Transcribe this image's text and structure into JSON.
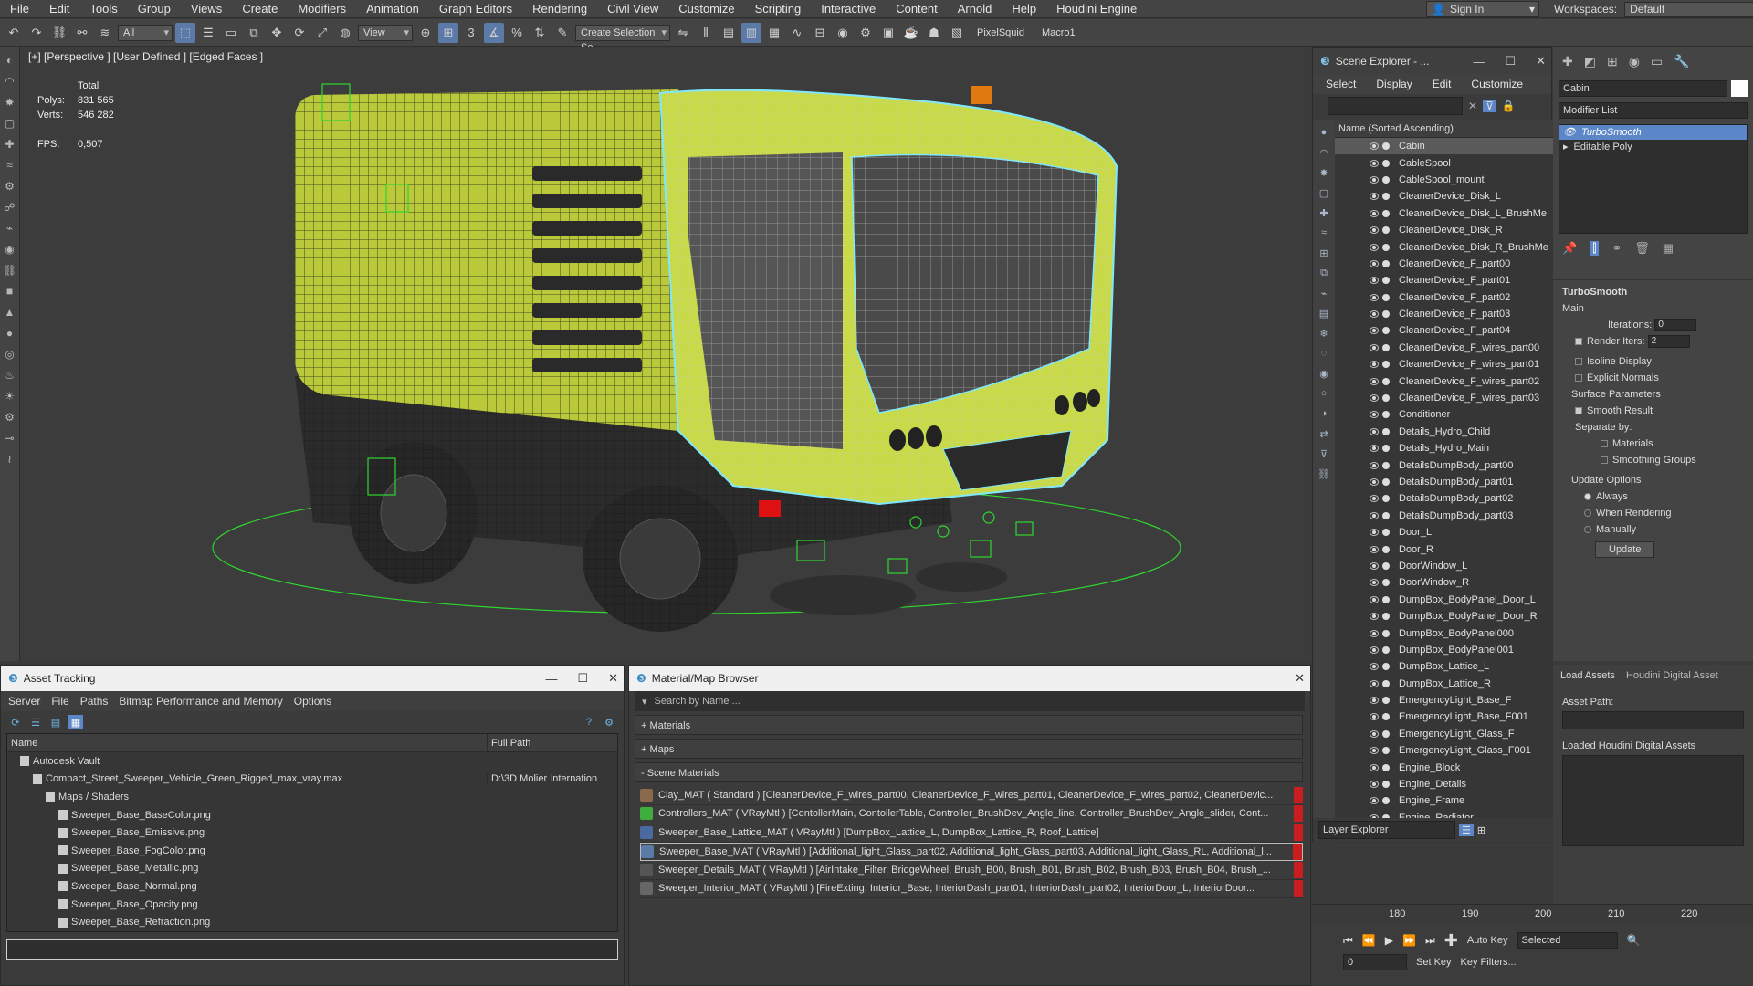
{
  "menubar": {
    "items": [
      "File",
      "Edit",
      "Tools",
      "Group",
      "Views",
      "Create",
      "Modifiers",
      "Animation",
      "Graph Editors",
      "Rendering",
      "Civil View",
      "Customize",
      "Scripting",
      "Interactive",
      "Content",
      "Arnold",
      "Help",
      "Houdini Engine"
    ],
    "sign_in": "Sign In",
    "workspaces_label": "Workspaces:",
    "workspace_value": "Default"
  },
  "toolbar": {
    "filter_value": "All",
    "view_value": "View",
    "selection_set": "Create Selection Se",
    "pixelsquid": "PixelSquid",
    "macro": "Macro1"
  },
  "viewport": {
    "label": "[+] [Perspective ] [User Defined ] [Edged Faces ]",
    "stats": {
      "total_label": "Total",
      "polys_label": "Polys:",
      "polys_value": "831 565",
      "verts_label": "Verts:",
      "verts_value": "546 282",
      "fps_label": "FPS:",
      "fps_value": "0,507"
    }
  },
  "scene_explorer": {
    "title": "Scene Explorer - ...",
    "menu": [
      "Select",
      "Display",
      "Edit",
      "Customize"
    ],
    "column_header": "Name (Sorted Ascending)",
    "items": [
      "Cabin",
      "CableSpool",
      "CableSpool_mount",
      "CleanerDevice_Disk_L",
      "CleanerDevice_Disk_L_BrushMe",
      "CleanerDevice_Disk_R",
      "CleanerDevice_Disk_R_BrushMe",
      "CleanerDevice_F_part00",
      "CleanerDevice_F_part01",
      "CleanerDevice_F_part02",
      "CleanerDevice_F_part03",
      "CleanerDevice_F_part04",
      "CleanerDevice_F_wires_part00",
      "CleanerDevice_F_wires_part01",
      "CleanerDevice_F_wires_part02",
      "CleanerDevice_F_wires_part03",
      "Conditioner",
      "Details_Hydro_Child",
      "Details_Hydro_Main",
      "DetailsDumpBody_part00",
      "DetailsDumpBody_part01",
      "DetailsDumpBody_part02",
      "DetailsDumpBody_part03",
      "Door_L",
      "Door_R",
      "DoorWindow_L",
      "DoorWindow_R",
      "DumpBox_BodyPanel_Door_L",
      "DumpBox_BodyPanel_Door_R",
      "DumpBox_BodyPanel000",
      "DumpBox_BodyPanel001",
      "DumpBox_Lattice_L",
      "DumpBox_Lattice_R",
      "EmergencyLight_Base_F",
      "EmergencyLight_Base_F001",
      "EmergencyLight_Glass_F",
      "EmergencyLight_Glass_F001",
      "Engine_Block",
      "Engine_Details",
      "Engine_Frame",
      "Engine_Radiator"
    ],
    "selected_item": "Cabin",
    "layer_explorer": "Layer Explorer"
  },
  "command_panel": {
    "object_name": "Cabin",
    "modifier_list": "Modifier List",
    "stack": [
      "TurboSmooth",
      "Editable Poly"
    ],
    "turbosmooth": {
      "title": "TurboSmooth",
      "main": "Main",
      "iterations_label": "Iterations:",
      "iterations_value": "0",
      "render_iters_label": "Render Iters:",
      "render_iters_value": "2",
      "isoline": "Isoline Display",
      "explicit_normals": "Explicit Normals",
      "surface_params": "Surface Parameters",
      "smooth_result": "Smooth Result",
      "separate_by": "Separate by:",
      "materials": "Materials",
      "smoothing_groups": "Smoothing Groups",
      "update_options": "Update Options",
      "always": "Always",
      "when_rendering": "When Rendering",
      "manually": "Manually",
      "update_button": "Update"
    }
  },
  "houdini_panel": {
    "tabs": [
      "Load Assets",
      "Houdini Digital Asset"
    ],
    "asset_path": "Asset Path:",
    "loaded_assets": "Loaded Houdini Digital Assets"
  },
  "asset_tracking": {
    "title": "Asset Tracking",
    "menu": [
      "Server",
      "File",
      "Paths",
      "Bitmap Performance and Memory",
      "Options"
    ],
    "columns": [
      "Name",
      "Full Path"
    ],
    "rows": [
      {
        "name": "Autodesk Vault",
        "path": "",
        "indent": 1
      },
      {
        "name": "Compact_Street_Sweeper_Vehicle_Green_Rigged_max_vray.max",
        "path": "D:\\3D Molier Internation",
        "indent": 2
      },
      {
        "name": "Maps / Shaders",
        "path": "",
        "indent": 3
      },
      {
        "name": "Sweeper_Base_BaseColor.png",
        "path": "",
        "indent": 4
      },
      {
        "name": "Sweeper_Base_Emissive.png",
        "path": "",
        "indent": 4
      },
      {
        "name": "Sweeper_Base_FogColor.png",
        "path": "",
        "indent": 4
      },
      {
        "name": "Sweeper_Base_Metallic.png",
        "path": "",
        "indent": 4
      },
      {
        "name": "Sweeper_Base_Normal.png",
        "path": "",
        "indent": 4
      },
      {
        "name": "Sweeper_Base_Opacity.png",
        "path": "",
        "indent": 4
      },
      {
        "name": "Sweeper_Base_Refraction.png",
        "path": "",
        "indent": 4
      }
    ]
  },
  "material_browser": {
    "title": "Material/Map Browser",
    "search_placeholder": "Search by Name ...",
    "sections": [
      "+ Materials",
      "+ Maps",
      "- Scene Materials"
    ],
    "materials": [
      {
        "text": "Clay_MAT  ( Standard ) [CleanerDevice_F_wires_part00, CleanerDevice_F_wires_part01, CleanerDevice_F_wires_part02, CleanerDevic...",
        "color": "#8a6a4a"
      },
      {
        "text": "Controllers_MAT ( VRayMtl ) [ContollerMain, ContollerTable, Controller_BrushDev_Angle_line, Controller_BrushDev_Angle_slider, Cont...",
        "color": "#3fae3f"
      },
      {
        "text": "Sweeper_Base_Lattice_MAT  ( VRayMtl ) [DumpBox_Lattice_L, DumpBox_Lattice_R, Roof_Lattice]",
        "color": "#4a6aa0"
      },
      {
        "text": "Sweeper_Base_MAT ( VRayMtl ) [Additional_light_Glass_part02, Additional_light_Glass_part03, Additional_light_Glass_RL, Additional_l...",
        "color": "#5a7aa8"
      },
      {
        "text": "Sweeper_Details_MAT  ( VRayMtl ) [AirIntake_Filter, BridgeWheel, Brush_B00, Brush_B01, Brush_B02, Brush_B03, Brush_B04, Brush_...",
        "color": "#555555"
      },
      {
        "text": "Sweeper_Interior_MAT ( VRayMtl ) [FireExting, Interior_Base, InteriorDash_part01, InteriorDash_part02, InteriorDoor_L, InteriorDoor...",
        "color": "#666666"
      }
    ]
  },
  "timeline": {
    "ticks": [
      "180",
      "190",
      "200",
      "210",
      "220"
    ],
    "auto_key": "Auto Key",
    "set_key": "Set Key",
    "key_mode": "Selected",
    "key_filters": "Key Filters...",
    "frame": "0"
  },
  "colors": {
    "body": "#c8d94a",
    "wire_select": "#7fe8ff",
    "helper_green": "#2fd62f",
    "material_red": "#c81e1e",
    "selection_blue": "#5b86c8"
  }
}
